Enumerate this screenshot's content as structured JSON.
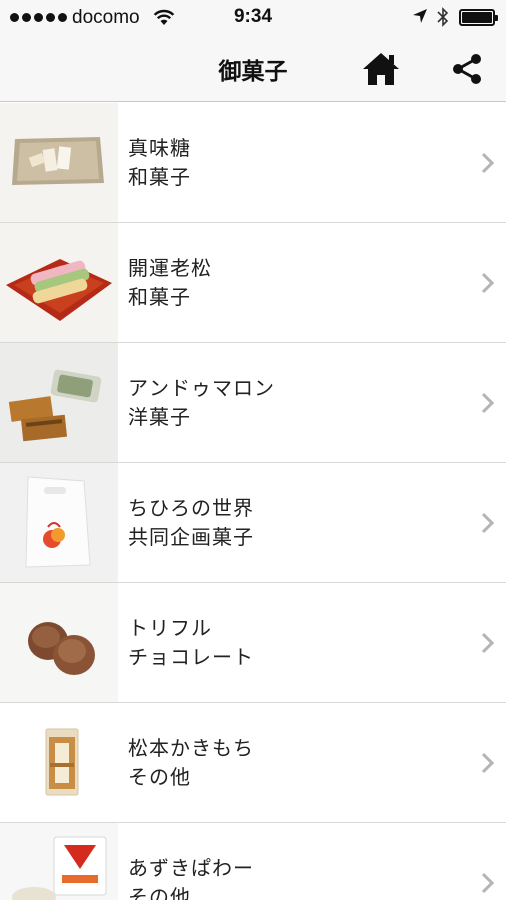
{
  "status": {
    "carrier": "docomo",
    "time": "9:34"
  },
  "nav": {
    "title": "御菓子",
    "home_icon": "home-icon",
    "share_icon": "share-icon"
  },
  "items": [
    {
      "name": "真味糖",
      "category": "和菓子"
    },
    {
      "name": "開運老松",
      "category": "和菓子"
    },
    {
      "name": "アンドゥマロン",
      "category": "洋菓子"
    },
    {
      "name": "ちひろの世界",
      "category": "共同企画菓子"
    },
    {
      "name": "トリフル",
      "category": "チョコレート"
    },
    {
      "name": "松本かきもち",
      "category": "その他"
    },
    {
      "name": "あずきぱわー",
      "category": "その他"
    }
  ]
}
